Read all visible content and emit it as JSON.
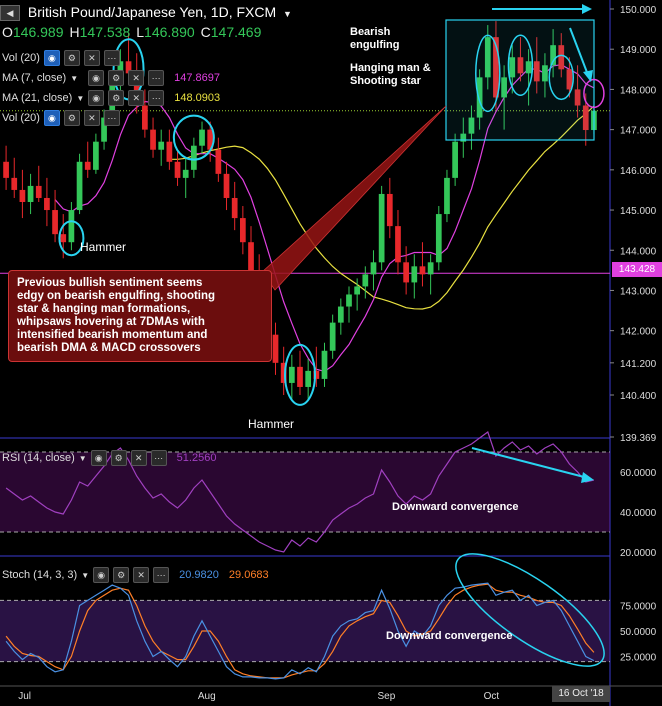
{
  "header": {
    "symbol_title": "British Pound/Japanese Yen, 1D, FXCM",
    "ohlc": [
      {
        "k": "O",
        "v": "146.989"
      },
      {
        "k": "H",
        "v": "147.538"
      },
      {
        "k": "L",
        "v": "146.890"
      },
      {
        "k": "C",
        "v": "147.469"
      }
    ]
  },
  "indicators": {
    "vol_top": {
      "label": "Vol (20)"
    },
    "ma7": {
      "label": "MA (7, close)",
      "value": "147.8697",
      "color": "#e040e0"
    },
    "ma21": {
      "label": "MA (21, close)",
      "value": "148.0903",
      "color": "#e8e040"
    },
    "vol_bottom": {
      "label": "Vol (20)"
    },
    "rsi": {
      "label": "RSI (14, close)",
      "value": "51.2560"
    },
    "stoch": {
      "label": "Stoch (14, 3, 3)",
      "k_value": "20.9820",
      "d_value": "29.0683",
      "k_color": "#4a90e2",
      "d_color": "#ff7f27"
    }
  },
  "annotations": {
    "bearish_engulfing": "Bearish\nengulfing",
    "hanging_man": "Hanging man &\nShooting star",
    "hammer_left": "Hammer",
    "hammer_bottom": "Hammer",
    "note": "Previous bullish sentiment seems\nedgy on bearish engulfing, shooting\nstar & hanging man formations,\nwhipsaws hovering at 7DMAs with\nintensified bearish momentum and\nbearish DMA & MACD crossovers",
    "rsi_conv": "Downward convergence",
    "stoch_conv": "Downward convergence"
  },
  "axis": {
    "price_ticks": [
      "150.000",
      "149.000",
      "148.000",
      "147.000",
      "146.000",
      "145.000",
      "144.000",
      "143.000",
      "142.000",
      "141.200",
      "140.400",
      "139.369"
    ],
    "current_price": "143.428",
    "rsi_ticks": [
      "60.0000",
      "40.0000",
      "20.0000"
    ],
    "stoch_ticks": [
      "75.0000",
      "50.0000",
      "25.0000"
    ],
    "x_labels": [
      "Jul",
      "Aug",
      "Sep",
      "Oct"
    ],
    "cursor_date": "16 Oct '18"
  },
  "chart_data": {
    "type": "candlestick",
    "title": "British Pound/Japanese Yen, 1D, FXCM",
    "xlabel": "",
    "ylabel": "",
    "ylim": [
      139.369,
      150.0
    ],
    "x_tick_labels": [
      "Jul",
      "Aug",
      "Sep",
      "Oct"
    ],
    "candles": [
      [
        146.2,
        146.6,
        145.5,
        145.8
      ],
      [
        145.8,
        146.3,
        145.3,
        145.5
      ],
      [
        145.5,
        146.0,
        144.8,
        145.2
      ],
      [
        145.2,
        145.9,
        144.9,
        145.6
      ],
      [
        145.6,
        146.1,
        145.2,
        145.3
      ],
      [
        145.3,
        145.8,
        144.6,
        145.0
      ],
      [
        145.0,
        145.5,
        144.2,
        144.4
      ],
      [
        144.4,
        144.9,
        143.8,
        144.2
      ],
      [
        144.2,
        145.2,
        144.0,
        145.0
      ],
      [
        145.0,
        146.4,
        144.9,
        146.2
      ],
      [
        146.2,
        146.7,
        145.8,
        146.0
      ],
      [
        146.0,
        146.9,
        145.9,
        146.7
      ],
      [
        146.7,
        147.5,
        146.5,
        147.3
      ],
      [
        147.3,
        148.4,
        147.1,
        148.2
      ],
      [
        148.2,
        149.0,
        147.9,
        148.7
      ],
      [
        148.7,
        149.4,
        148.2,
        148.4
      ],
      [
        148.4,
        148.9,
        147.4,
        147.6
      ],
      [
        147.6,
        148.0,
        146.8,
        147.0
      ],
      [
        147.0,
        147.3,
        146.3,
        146.5
      ],
      [
        146.5,
        147.0,
        146.1,
        146.7
      ],
      [
        146.7,
        147.0,
        146.0,
        146.2
      ],
      [
        146.2,
        146.5,
        145.6,
        145.8
      ],
      [
        145.8,
        146.3,
        145.3,
        146.0
      ],
      [
        146.0,
        146.8,
        145.8,
        146.6
      ],
      [
        146.6,
        147.2,
        146.4,
        147.0
      ],
      [
        147.0,
        147.2,
        146.2,
        146.5
      ],
      [
        146.5,
        146.8,
        145.7,
        145.9
      ],
      [
        145.9,
        146.2,
        145.0,
        145.3
      ],
      [
        145.3,
        145.7,
        144.5,
        144.8
      ],
      [
        144.8,
        145.1,
        143.9,
        144.2
      ],
      [
        144.2,
        144.6,
        143.2,
        143.5
      ],
      [
        143.5,
        143.9,
        142.4,
        142.7
      ],
      [
        142.7,
        143.1,
        141.6,
        141.9
      ],
      [
        141.9,
        142.2,
        140.9,
        141.2
      ],
      [
        141.2,
        141.6,
        140.4,
        140.7
      ],
      [
        140.7,
        141.4,
        140.3,
        141.1
      ],
      [
        141.1,
        141.5,
        140.4,
        140.6
      ],
      [
        140.6,
        141.3,
        140.3,
        141.0
      ],
      [
        141.0,
        141.6,
        140.6,
        140.8
      ],
      [
        140.8,
        141.7,
        140.6,
        141.5
      ],
      [
        141.5,
        142.4,
        141.3,
        142.2
      ],
      [
        142.2,
        142.8,
        141.9,
        142.6
      ],
      [
        142.6,
        143.1,
        142.2,
        142.9
      ],
      [
        142.9,
        143.3,
        142.5,
        143.1
      ],
      [
        143.1,
        143.6,
        142.8,
        143.4
      ],
      [
        143.4,
        144.0,
        143.0,
        143.7
      ],
      [
        143.7,
        145.6,
        143.5,
        145.4
      ],
      [
        145.4,
        145.8,
        144.3,
        144.6
      ],
      [
        144.6,
        145.0,
        143.4,
        143.7
      ],
      [
        143.7,
        144.1,
        142.9,
        143.2
      ],
      [
        143.2,
        143.9,
        142.8,
        143.6
      ],
      [
        143.6,
        144.2,
        143.1,
        143.4
      ],
      [
        143.4,
        143.9,
        142.9,
        143.7
      ],
      [
        143.7,
        145.1,
        143.5,
        144.9
      ],
      [
        144.9,
        146.0,
        144.7,
        145.8
      ],
      [
        145.8,
        146.9,
        145.6,
        146.7
      ],
      [
        146.7,
        147.3,
        146.3,
        146.9
      ],
      [
        146.9,
        147.6,
        146.5,
        147.3
      ],
      [
        147.3,
        148.5,
        147.0,
        148.3
      ],
      [
        148.3,
        149.6,
        148.0,
        149.3
      ],
      [
        149.3,
        149.7,
        147.5,
        147.8
      ],
      [
        147.8,
        148.6,
        147.0,
        148.3
      ],
      [
        148.3,
        149.1,
        147.9,
        148.8
      ],
      [
        148.8,
        149.3,
        148.2,
        148.4
      ],
      [
        148.4,
        149.0,
        147.6,
        148.7
      ],
      [
        148.7,
        149.3,
        147.9,
        148.2
      ],
      [
        148.2,
        148.9,
        147.8,
        148.6
      ],
      [
        148.6,
        149.5,
        148.3,
        149.1
      ],
      [
        149.1,
        149.4,
        148.3,
        148.5
      ],
      [
        148.5,
        148.8,
        147.8,
        148.0
      ],
      [
        148.0,
        148.6,
        147.3,
        147.6
      ],
      [
        147.6,
        147.9,
        146.6,
        146.99
      ],
      [
        146.99,
        147.54,
        146.89,
        147.47
      ]
    ],
    "series": [
      {
        "name": "MA (7, close)",
        "type": "line",
        "color": "#e040e0"
      },
      {
        "name": "MA (21, close)",
        "type": "line",
        "color": "#e8e040"
      }
    ],
    "rsi": {
      "ylim": [
        20,
        80
      ],
      "values": [
        52,
        49,
        46,
        48,
        45,
        42,
        40,
        39,
        46,
        55,
        53,
        58,
        63,
        69,
        72,
        66,
        58,
        52,
        47,
        49,
        45,
        42,
        46,
        52,
        56,
        50,
        44,
        38,
        34,
        31,
        28,
        25,
        23,
        21,
        20,
        26,
        23,
        27,
        25,
        30,
        36,
        39,
        42,
        44,
        47,
        49,
        61,
        55,
        48,
        44,
        48,
        46,
        49,
        58,
        64,
        70,
        72,
        74,
        77,
        80,
        68,
        72,
        75,
        71,
        73,
        69,
        72,
        74,
        70,
        64,
        60,
        55,
        56
      ]
    },
    "stoch": {
      "ylim": [
        0,
        100
      ],
      "k": [
        40,
        30,
        22,
        28,
        24,
        15,
        10,
        12,
        40,
        75,
        80,
        85,
        90,
        95,
        92,
        85,
        60,
        40,
        25,
        30,
        22,
        15,
        25,
        45,
        60,
        45,
        30,
        15,
        8,
        5,
        5,
        4,
        4,
        3,
        4,
        12,
        8,
        14,
        10,
        25,
        45,
        55,
        60,
        62,
        68,
        70,
        90,
        72,
        50,
        35,
        50,
        45,
        55,
        75,
        85,
        92,
        93,
        95,
        96,
        97,
        85,
        88,
        90,
        80,
        85,
        75,
        78,
        80,
        70,
        55,
        40,
        25,
        21
      ],
      "d": [
        45,
        35,
        28,
        26,
        25,
        20,
        15,
        12,
        25,
        50,
        70,
        80,
        85,
        90,
        92,
        90,
        75,
        55,
        40,
        30,
        26,
        22,
        22,
        35,
        50,
        50,
        40,
        25,
        12,
        8,
        6,
        5,
        4,
        4,
        4,
        7,
        9,
        11,
        11,
        18,
        30,
        45,
        55,
        60,
        64,
        67,
        80,
        78,
        65,
        50,
        45,
        47,
        50,
        62,
        75,
        85,
        90,
        93,
        95,
        96,
        90,
        88,
        88,
        85,
        83,
        80,
        78,
        78,
        75,
        65,
        52,
        38,
        29
      ]
    }
  }
}
